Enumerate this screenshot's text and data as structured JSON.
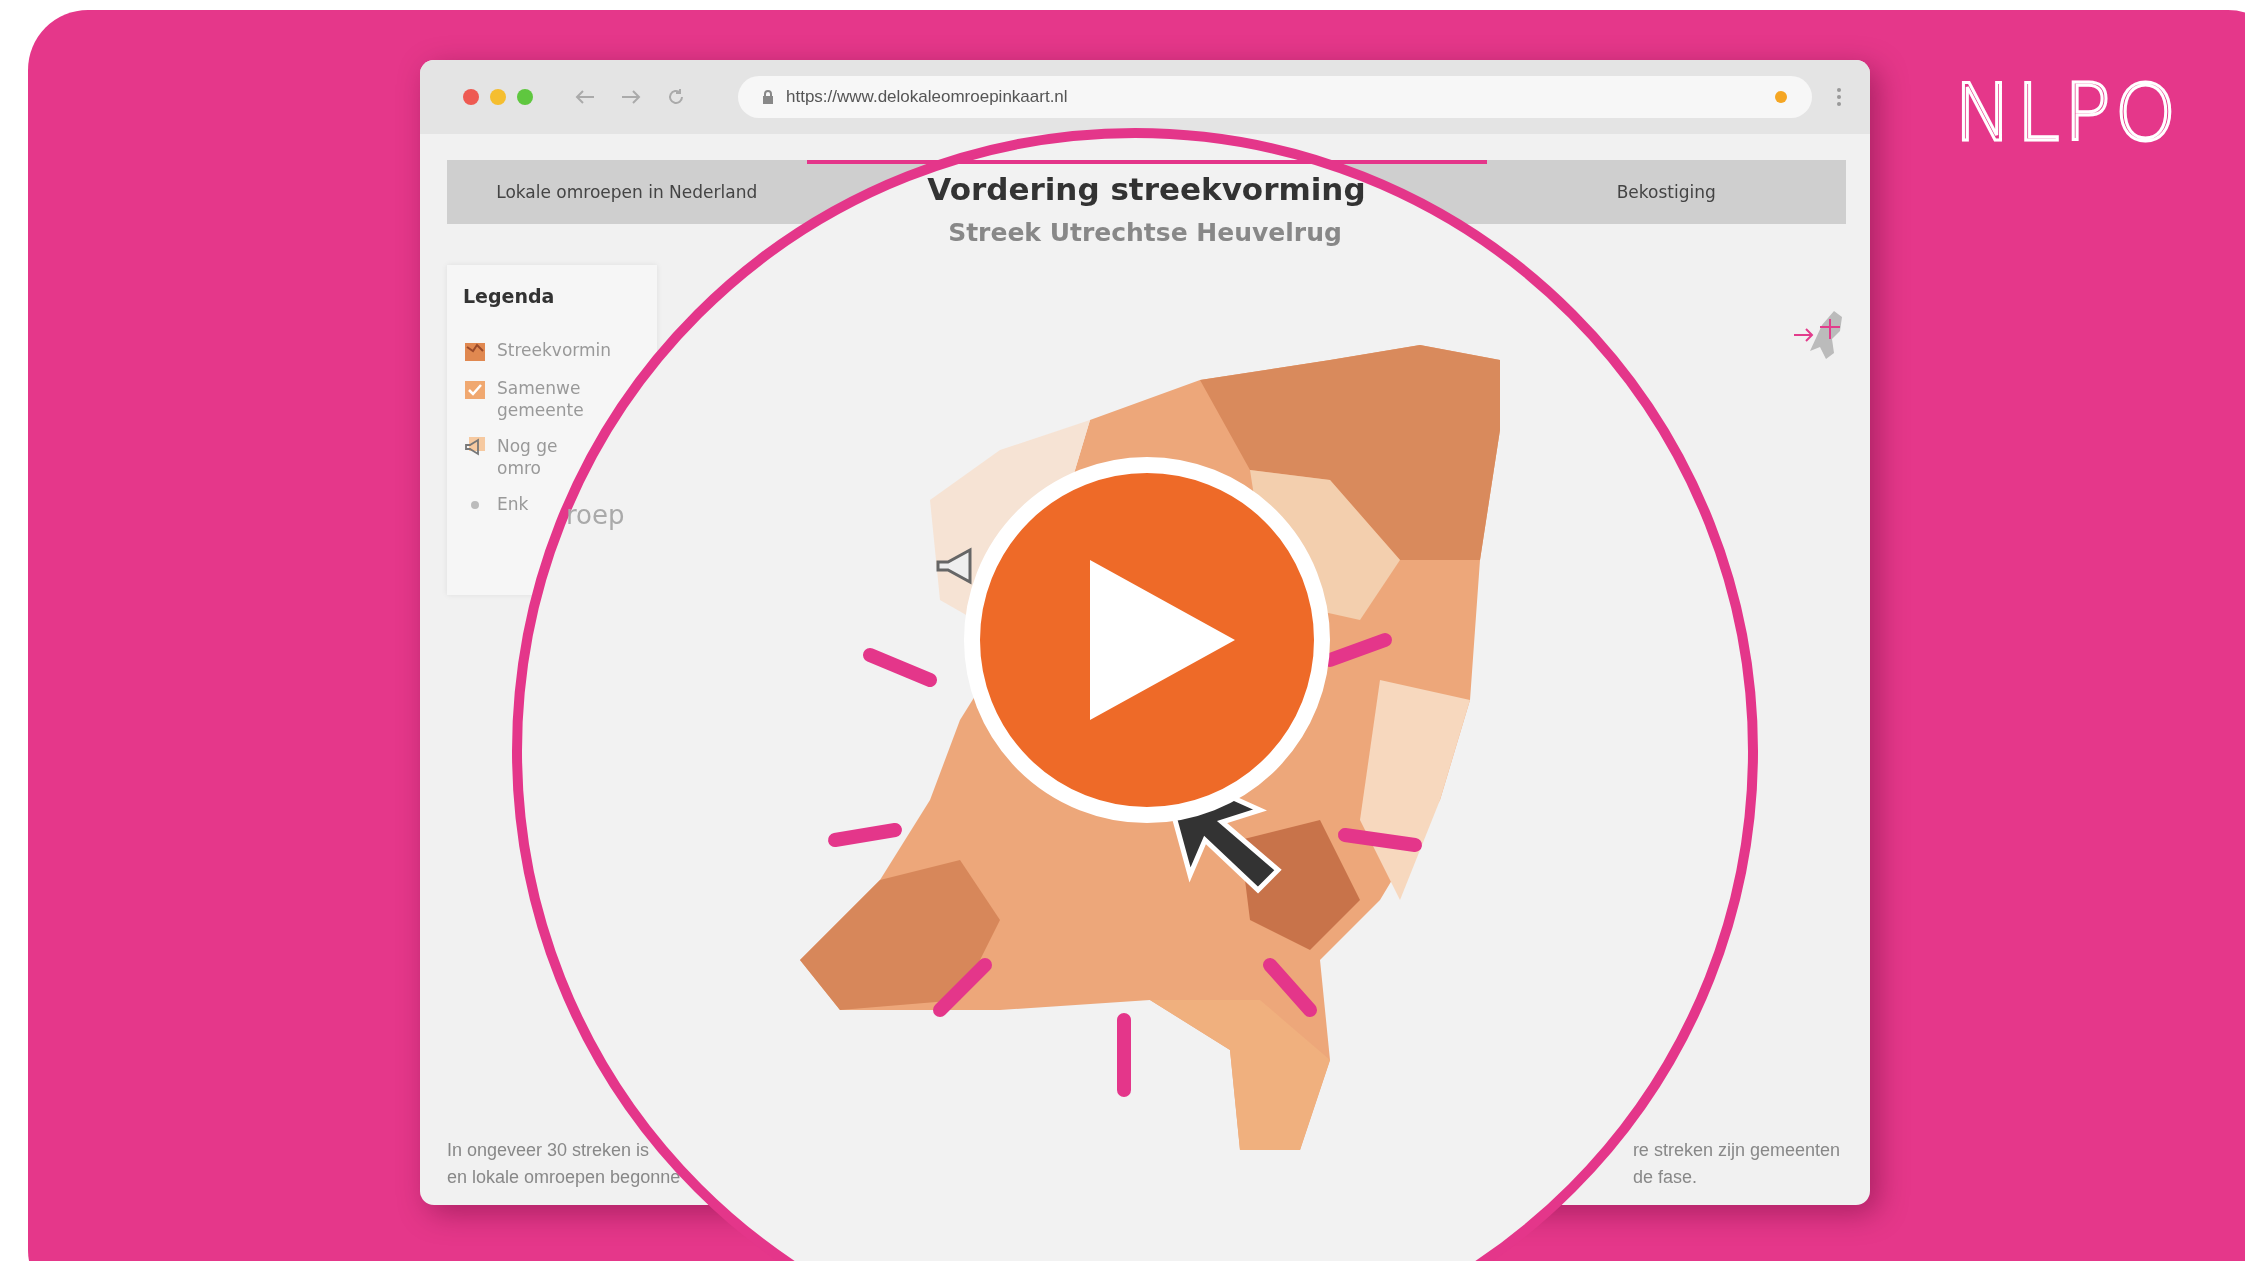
{
  "logo": "NLPO",
  "browser": {
    "url": "https://www.delokaleomroepinkaart.nl"
  },
  "tabs": [
    {
      "label": "Lokale omroepen in Nederland",
      "selected": false
    },
    {
      "label": "Vordering streekvorming",
      "selected": true
    },
    {
      "label": "Bekostiging",
      "selected": false
    }
  ],
  "subtitle": "Streek Utrechtse Heuvelrug",
  "legend": {
    "title": "Legenda",
    "items": [
      {
        "kind": "region",
        "lines": [
          "Streekvormin"
        ]
      },
      {
        "kind": "partner",
        "lines": [
          "Samenwe",
          "gemeente"
        ]
      },
      {
        "kind": "megaphone",
        "lines": [
          "Nog ge",
          "omro"
        ]
      },
      {
        "kind": "dot",
        "lines": [
          "Enk"
        ]
      }
    ]
  },
  "map_label": "roep",
  "footer_left": [
    "In ongeveer 30 streken is",
    "en lokale omroepen begonne"
  ],
  "footer_right": [
    "re streken zijn gemeenten",
    "de fase."
  ]
}
